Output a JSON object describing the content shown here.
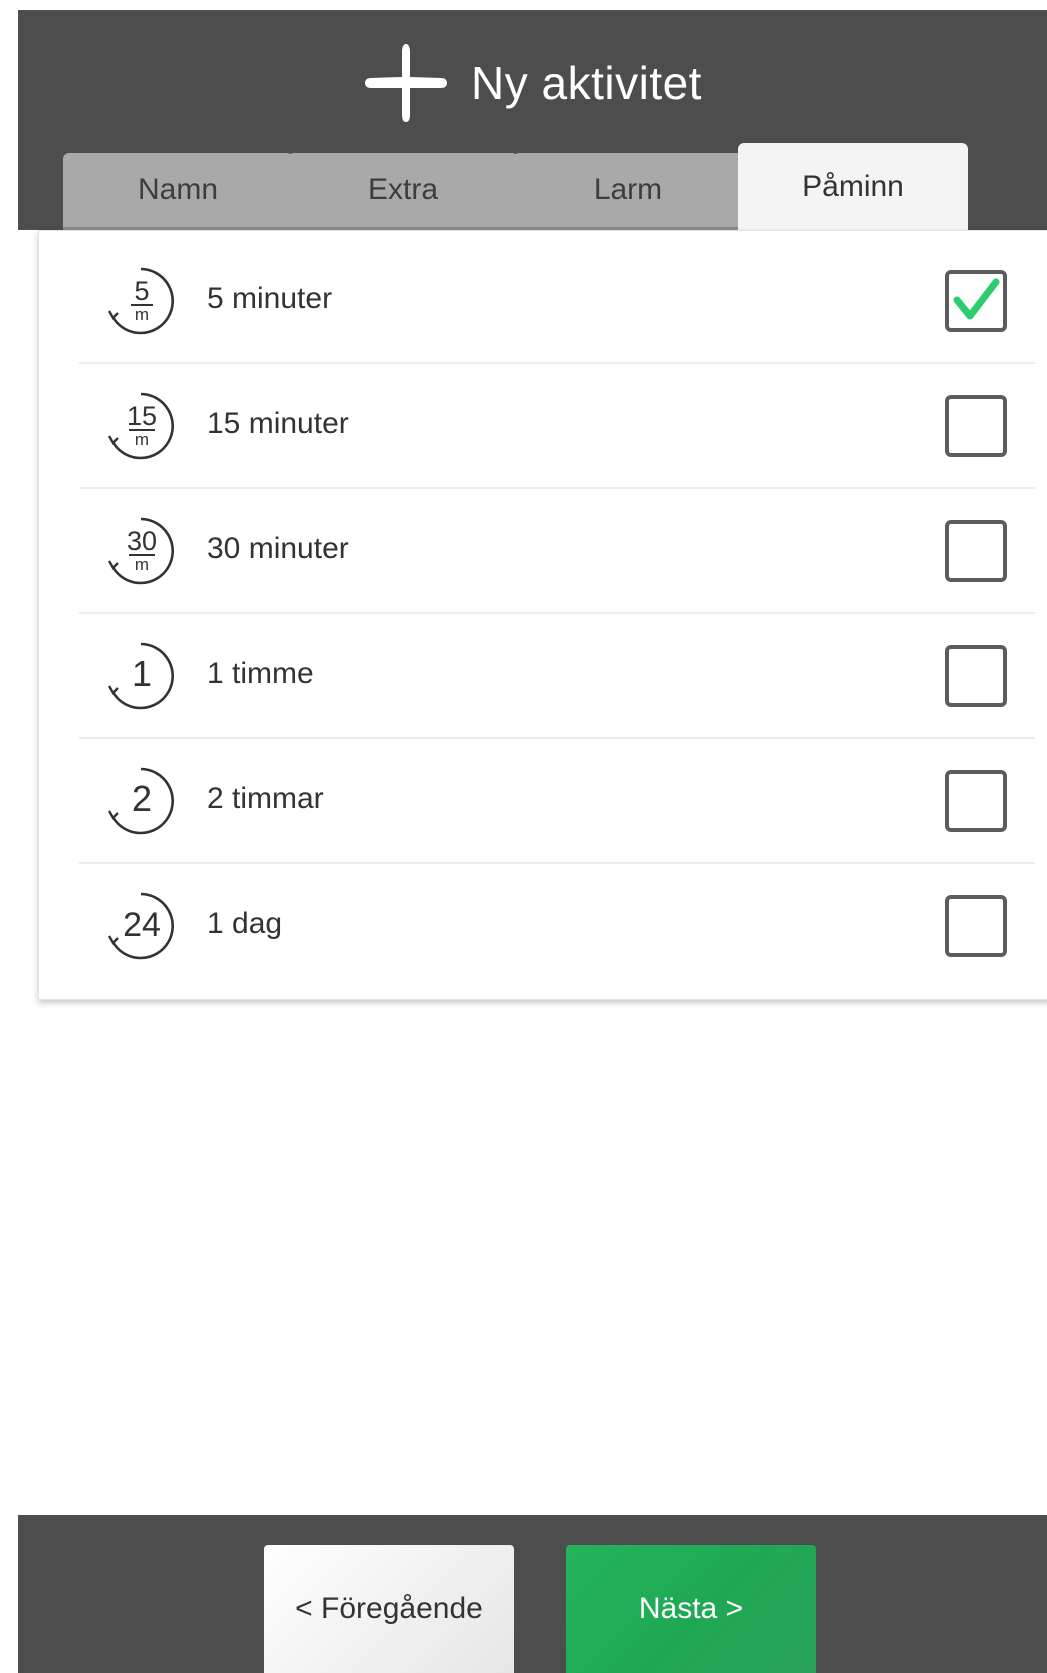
{
  "header": {
    "title": "Ny aktivitet",
    "icon": "plus-icon"
  },
  "tabs": [
    {
      "label": "Namn",
      "active": false
    },
    {
      "label": "Extra",
      "active": false
    },
    {
      "label": "Larm",
      "active": false
    },
    {
      "label": "Påminn",
      "active": true
    }
  ],
  "reminders": [
    {
      "icon_text": "5",
      "icon_sub": "m",
      "label": "5 minuter",
      "checked": true
    },
    {
      "icon_text": "15",
      "icon_sub": "m",
      "label": "15 minuter",
      "checked": false
    },
    {
      "icon_text": "30",
      "icon_sub": "m",
      "label": "30 minuter",
      "checked": false
    },
    {
      "icon_text": "1",
      "icon_sub": "",
      "label": "1 timme",
      "checked": false
    },
    {
      "icon_text": "2",
      "icon_sub": "",
      "label": "2 timmar",
      "checked": false
    },
    {
      "icon_text": "24",
      "icon_sub": "",
      "label": "1 dag",
      "checked": false
    }
  ],
  "footer": {
    "prev_label": "< Föregående",
    "next_label": "Nästa >"
  },
  "colors": {
    "header_bg": "#4d4d4d",
    "accent_green": "#22b05a",
    "check_green": "#2ecc71"
  }
}
